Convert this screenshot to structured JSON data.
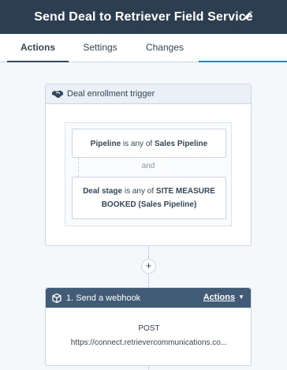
{
  "header": {
    "title": "Send Deal to Retriever Field Service",
    "edit_icon": "pencil-icon"
  },
  "tabs": [
    {
      "label": "Actions",
      "active": true
    },
    {
      "label": "Settings",
      "active": false
    },
    {
      "label": "Changes",
      "active": false
    }
  ],
  "trigger": {
    "icon": "handshake-icon",
    "title": "Deal enrollment trigger",
    "conditions": [
      {
        "property": "Pipeline",
        "operator": " is any of ",
        "value": "Sales Pipeline"
      },
      {
        "property": "Deal stage",
        "operator": " is any of ",
        "value": "SITE MEASURE BOOKED (Sales Pipeline)"
      }
    ],
    "joiner": "and"
  },
  "add_button": "+",
  "action": {
    "icon": "cube-icon",
    "title": "1. Send a webhook",
    "menu_label": "Actions",
    "method": "POST",
    "url": "https://connect.retrievercommunications.co..."
  },
  "colors": {
    "header_bg": "#2d3e50",
    "action_header_bg": "#425b76",
    "accent": "#0091ae"
  }
}
